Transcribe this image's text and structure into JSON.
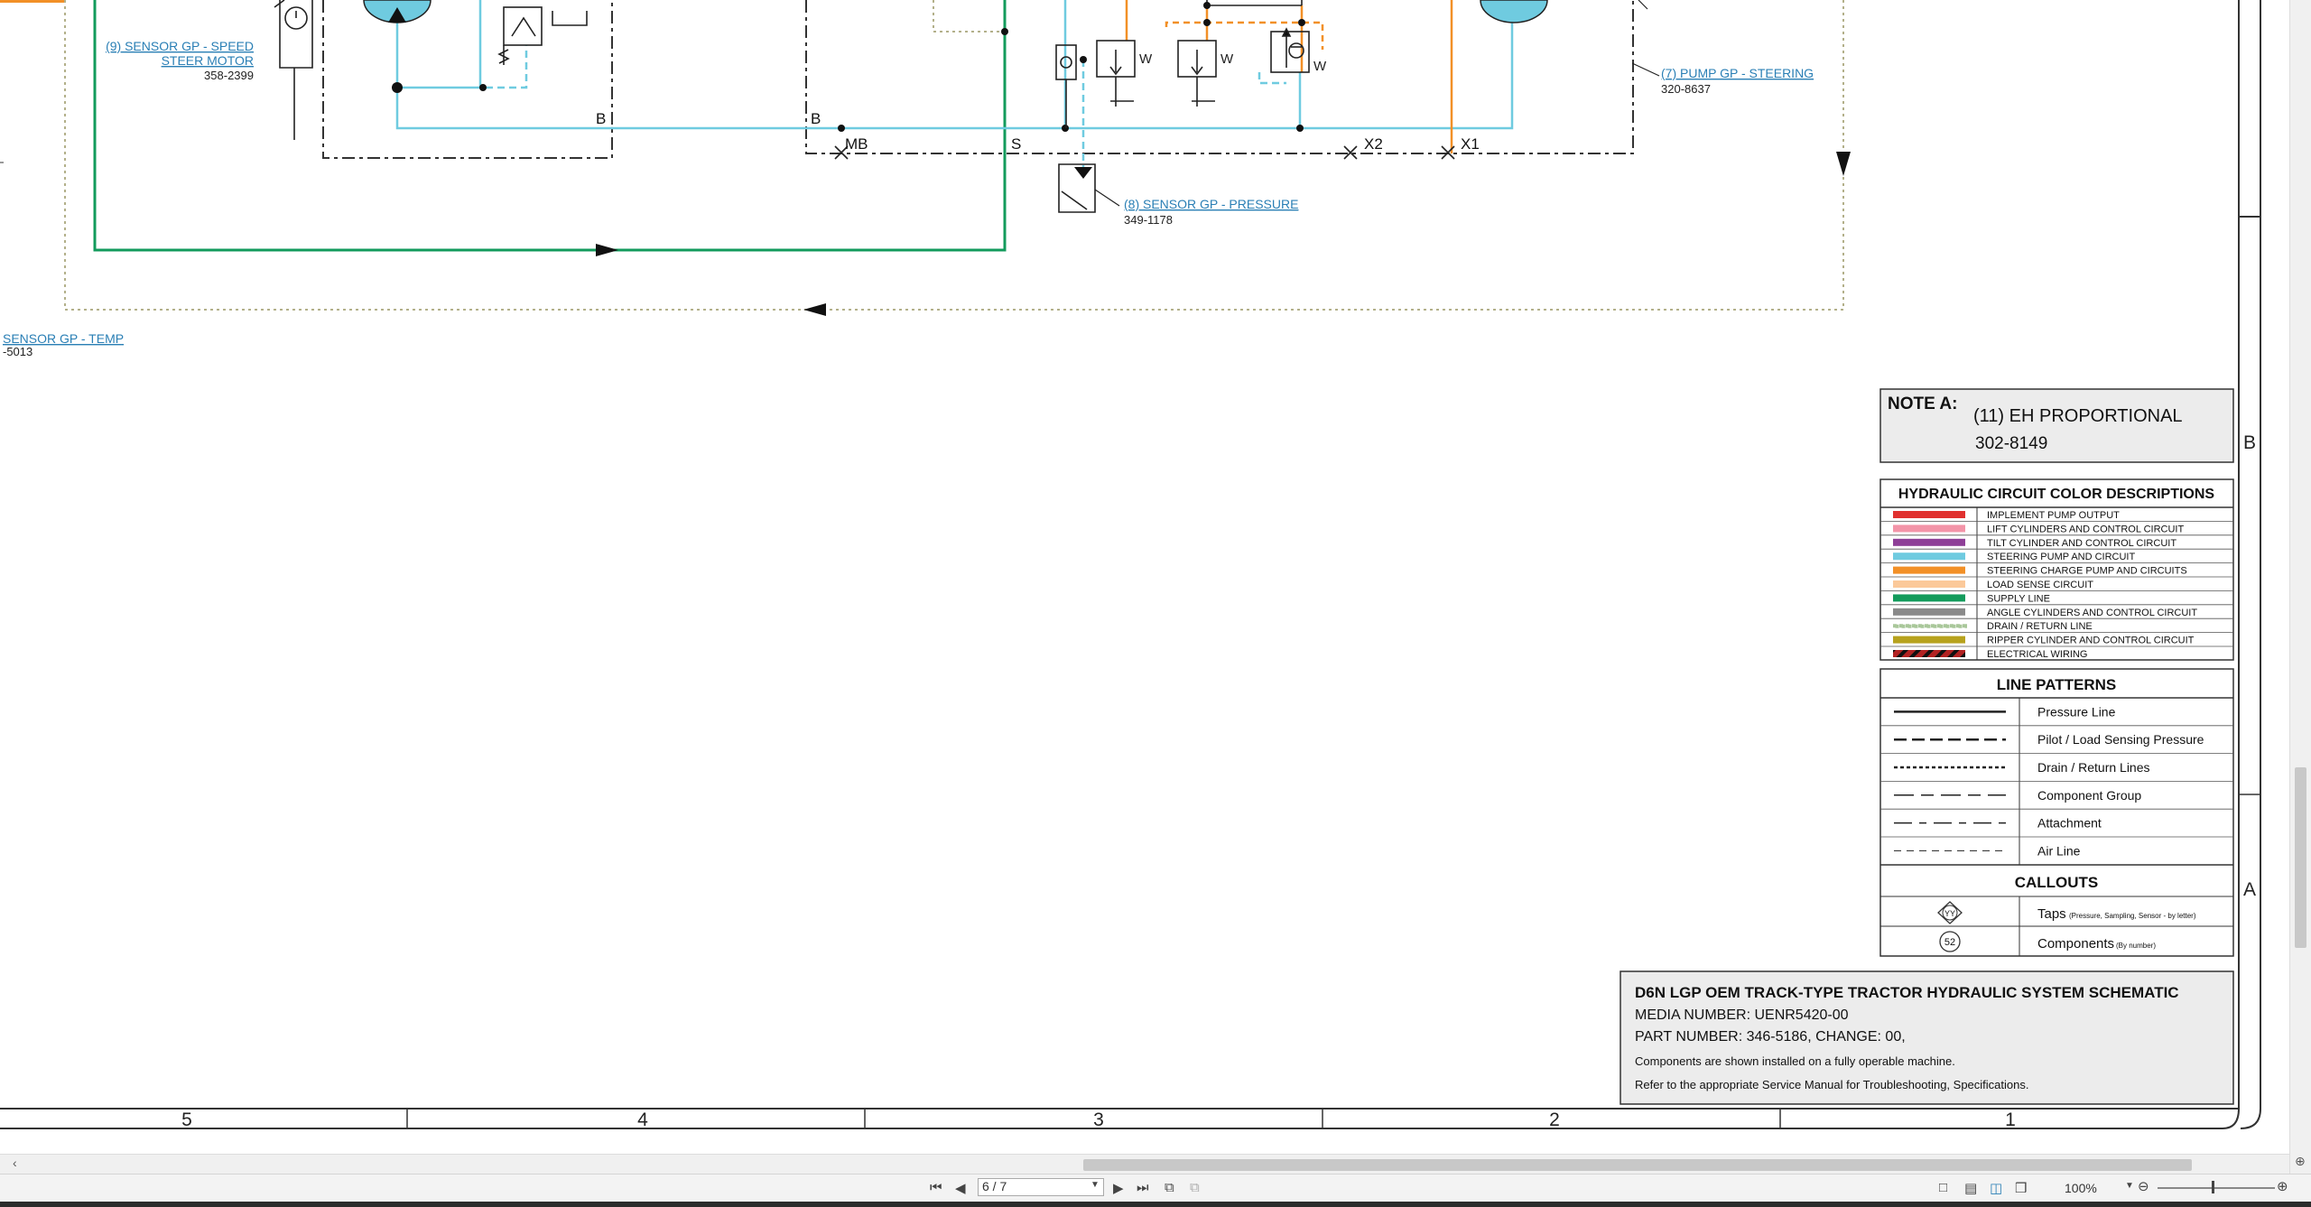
{
  "labels": {
    "sensor_speed_line1": "(9) SENSOR GP - SPEED",
    "sensor_speed_line2": "STEER MOTOR",
    "sensor_speed_part": "358-2399",
    "sensor_temp": "SENSOR GP - TEMP",
    "sensor_temp_part": "-5013",
    "pump_steering": "(7) PUMP GP - STEERING",
    "pump_steering_part": "320-8637",
    "sensor_pressure": "(8) SENSOR GP - PRESSURE",
    "sensor_pressure_part": "349-1178",
    "port_b1": "B",
    "port_b2": "B",
    "port_mb": "MB",
    "port_s": "S",
    "port_x2": "X2",
    "port_x1": "X1",
    "spring_w": "W"
  },
  "note_a": {
    "title": "NOTE A:",
    "line1": "(11) EH PROPORTIONAL",
    "line2": "302-8149"
  },
  "color_legend": {
    "title": "HYDRAULIC CIRCUIT COLOR DESCRIPTIONS",
    "items": [
      {
        "label": "IMPLEMENT PUMP OUTPUT",
        "color": "#e0312f"
      },
      {
        "label": "LIFT CYLINDERS AND CONTROL CIRCUIT",
        "color": "#f394a8"
      },
      {
        "label": "TILT CYLINDER AND CONTROL CIRCUIT",
        "color": "#8e3f97"
      },
      {
        "label": "STEERING PUMP AND CIRCUIT",
        "color": "#6fcbe0"
      },
      {
        "label": "STEERING CHARGE PUMP AND CIRCUITS",
        "color": "#f29027"
      },
      {
        "label": "LOAD SENSE CIRCUIT",
        "color": "#fbc99a"
      },
      {
        "label": "SUPPLY LINE",
        "color": "#139b5c"
      },
      {
        "label": "ANGLE CYLINDERS AND CONTROL CIRCUIT",
        "color": "#8a8a8a"
      },
      {
        "label": "DRAIN / RETURN LINE",
        "color": "#a9c79a"
      },
      {
        "label": "RIPPER CYLINDER AND CONTROL CIRCUIT",
        "color": "#b7a21d"
      },
      {
        "label": "ELECTRICAL WIRING",
        "color": "#b22222"
      }
    ]
  },
  "line_patterns": {
    "title": "LINE PATTERNS",
    "items": [
      {
        "label": "Pressure Line"
      },
      {
        "label": "Pilot / Load Sensing Pressure"
      },
      {
        "label": "Drain / Return Lines"
      },
      {
        "label": "Component Group"
      },
      {
        "label": "Attachment"
      },
      {
        "label": "Air Line"
      }
    ]
  },
  "callouts": {
    "title": "CALLOUTS",
    "taps_symbol": "YY",
    "taps_label": "Taps",
    "taps_note": "(Pressure, Sampling, Sensor - by letter)",
    "comp_symbol": "52",
    "comp_label": "Components",
    "comp_note": "(By number)"
  },
  "title_block": {
    "title": "D6N LGP OEM TRACK-TYPE TRACTOR HYDRAULIC SYSTEM SCHEMATIC",
    "media": "MEDIA NUMBER: UENR5420-00",
    "part": "PART NUMBER: 346-5186, CHANGE: 00,",
    "note1": "Components are shown installed on a fully operable machine.",
    "note2": "Refer to the appropriate Service Manual for Troubleshooting, Specifications."
  },
  "grid": {
    "columns": [
      "5",
      "4",
      "3",
      "2",
      "1"
    ],
    "rows": [
      "B",
      "A"
    ]
  },
  "toolbar": {
    "page": "6 / 7",
    "zoom": "100%"
  },
  "colors": {
    "steering": "#6fcbe0",
    "supply": "#139b5c",
    "charge": "#f29027",
    "drain": "#b3b08a"
  }
}
